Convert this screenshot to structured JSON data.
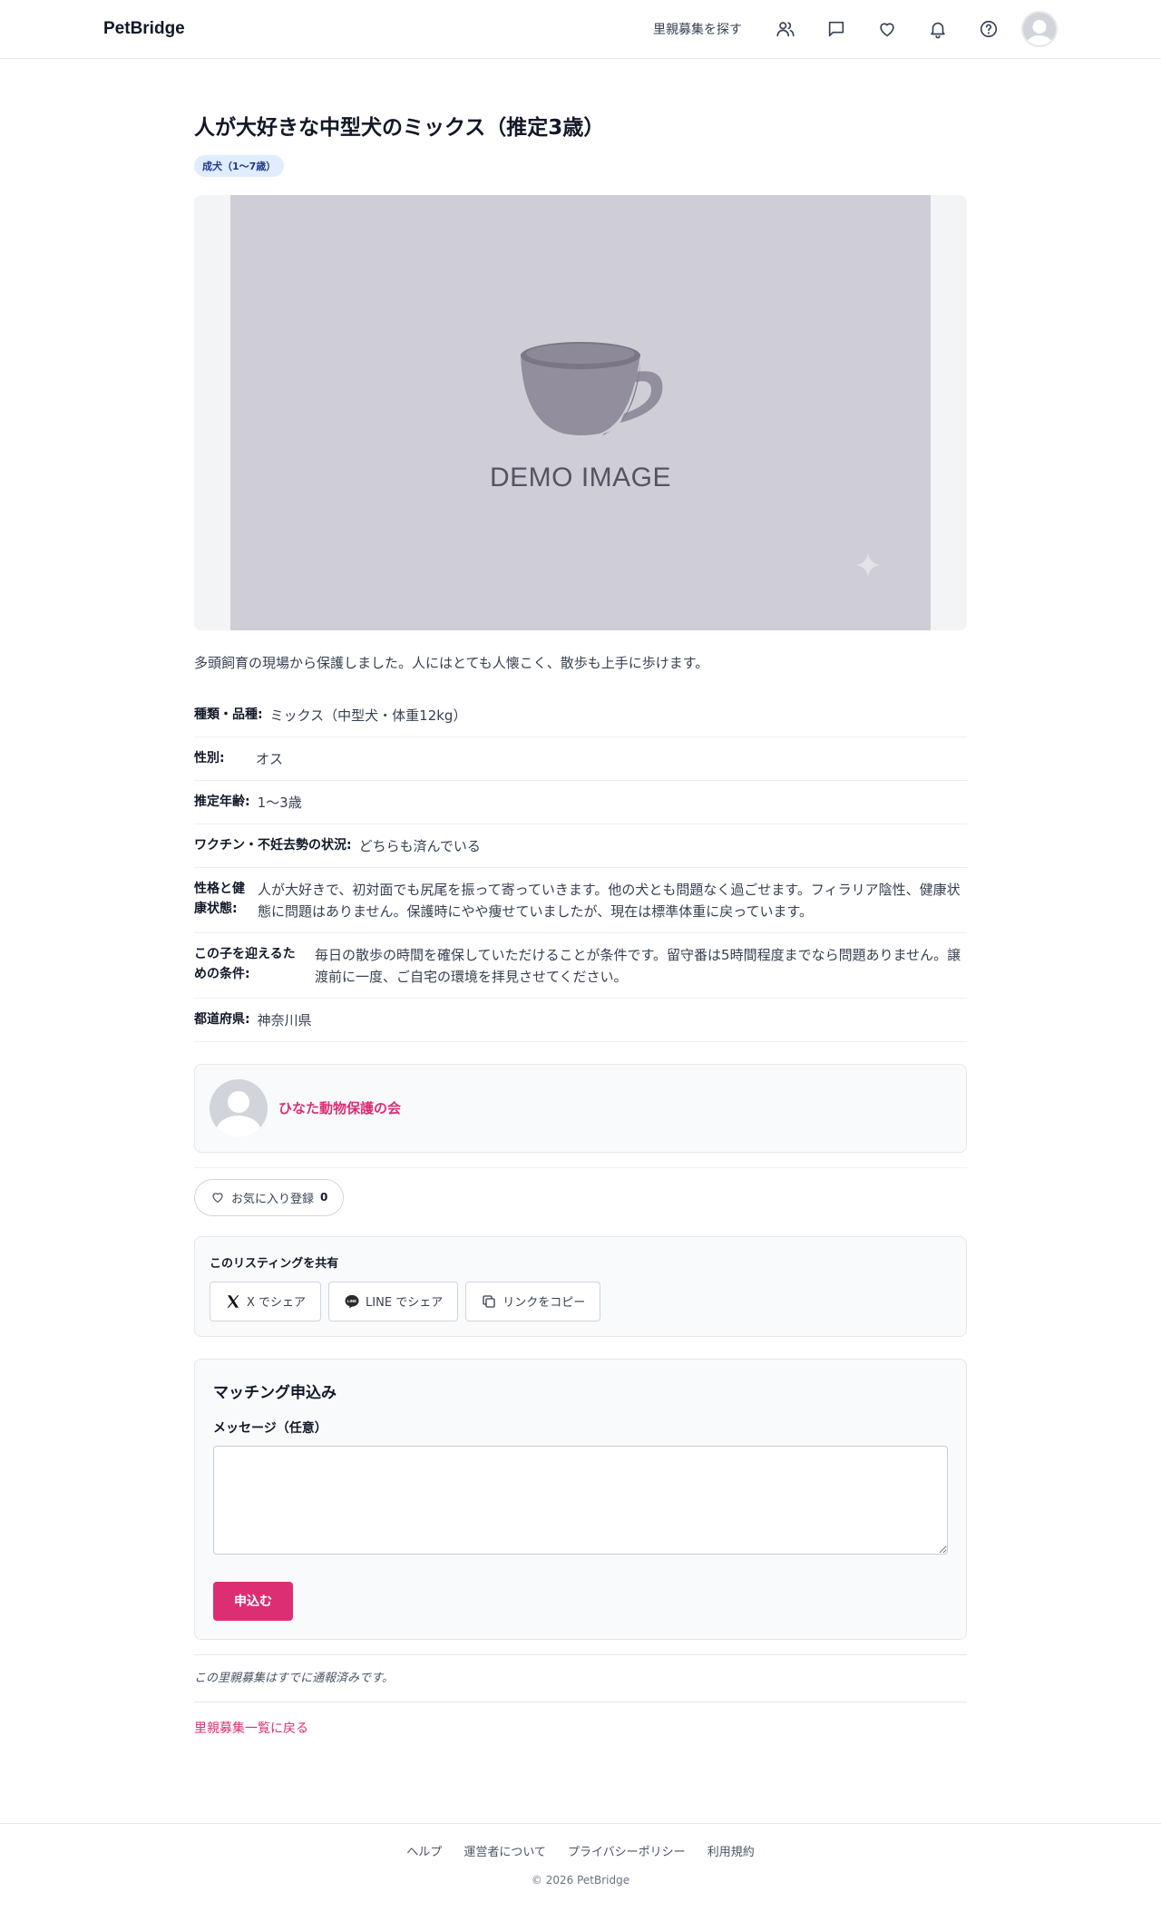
{
  "header": {
    "brand": "PetBridge",
    "nav_link": "里親募集を探す",
    "icons": [
      "users-icon",
      "message-icon",
      "heart-icon",
      "bell-icon",
      "help-icon"
    ]
  },
  "listing": {
    "title": "人が大好きな中型犬のミックス（推定3歳）",
    "badge": "成犬（1〜7歳）",
    "photo_text": "DEMO IMAGE",
    "description": "多頭飼育の現場から保護しました。人にはとても人懐こく、散歩も上手に歩けます。",
    "details": [
      {
        "label": "種類・品種:",
        "value": "ミックス（中型犬・体重12kg）"
      },
      {
        "label": "性別:",
        "value": "オス"
      },
      {
        "label": "推定年齢:",
        "value": "1〜3歳"
      },
      {
        "label": "ワクチン・不妊去勢の状況:",
        "value": "どちらも済んでいる"
      },
      {
        "label": "性格と健康状態:",
        "value": "人が大好きで、初対面でも尻尾を振って寄っていきます。他の犬とも問題なく過ごせます。フィラリア陰性、健康状態に問題はありません。保護時にやや痩せていましたが、現在は標準体重に戻っています。"
      },
      {
        "label": "この子を迎えるための条件:",
        "value": "毎日の散歩の時間を確保していただけることが条件です。留守番は5時間程度までなら問題ありません。譲渡前に一度、ご自宅の環境を拝見させてください。"
      },
      {
        "label": "都道府県:",
        "value": "神奈川県"
      }
    ]
  },
  "organization": {
    "name": "ひなた動物保護の会"
  },
  "favorite": {
    "label": "お気に入り登録",
    "count": "0"
  },
  "share": {
    "title": "このリスティングを共有",
    "x_label": "X でシェア",
    "line_label": "LINE でシェア",
    "copy_label": "リンクをコピー"
  },
  "match": {
    "title": "マッチング申込み",
    "message_label": "メッセージ（任意）",
    "message_value": "",
    "submit_label": "申込む"
  },
  "report_note": "この里親募集はすでに通報済みです。",
  "back_link": "里親募集一覧に戻る",
  "footer": {
    "links": [
      "ヘルプ",
      "運営者について",
      "プライバシーポリシー",
      "利用規約"
    ],
    "copyright": "© 2026 PetBridge"
  },
  "colors": {
    "accent": "#db2f76",
    "badge_bg": "#e0ecff",
    "badge_text": "#1e3a8a"
  }
}
